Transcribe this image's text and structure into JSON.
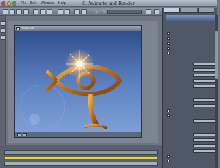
{
  "window": {
    "title": "8. Animate and Render",
    "menus": [
      "File",
      "Edit",
      "Window",
      "Help"
    ]
  },
  "toolbar": {
    "brand": "ervia"
  },
  "viewport": {
    "title": "Camera"
  }
}
